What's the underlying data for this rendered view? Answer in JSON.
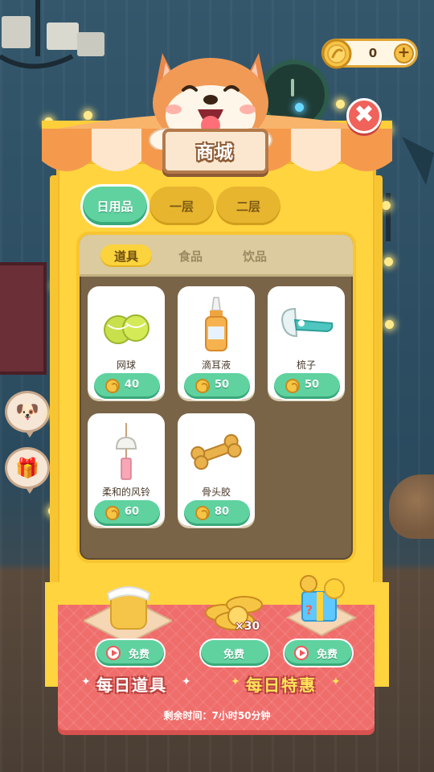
{
  "shop": {
    "title": "商城",
    "floor_tabs": [
      "日用品",
      "一层",
      "二层"
    ],
    "active_floor_tab": "日用品",
    "sub_tabs": [
      "道具",
      "食品",
      "饮品"
    ],
    "active_sub_tab": "道具"
  },
  "coins": {
    "value": "0"
  },
  "items": [
    {
      "name": "网球",
      "price": "40",
      "icon": "tennis-balls-icon"
    },
    {
      "name": "滴耳液",
      "price": "50",
      "icon": "ear-drops-bottle-icon"
    },
    {
      "name": "梳子",
      "price": "50",
      "icon": "comb-icon"
    },
    {
      "name": "柔和的风铃",
      "price": "60",
      "icon": "wind-chime-icon"
    },
    {
      "name": "骨头胶",
      "price": "80",
      "icon": "bone-chew-icon"
    }
  ],
  "daily": {
    "free_label": "免费",
    "coin_multiplier": "×30",
    "daily_items_title": "每日道具",
    "daily_deals_title": "每日特惠",
    "remaining_time": "剩余时间：7小时50分钟"
  },
  "colors": {
    "accent_green": "#5fd2a0",
    "frame_yellow": "#ffd43f",
    "stall_red": "#ef6d6a",
    "close_red": "#f0625a"
  }
}
